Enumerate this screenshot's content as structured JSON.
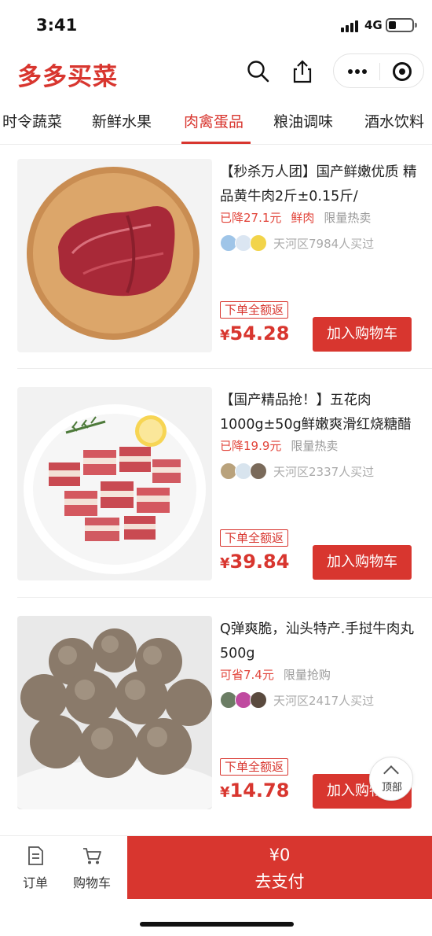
{
  "status_bar": {
    "time": "3:41",
    "network": "4G"
  },
  "header": {
    "brand": "多多买菜",
    "icons": [
      "search-icon",
      "share-icon",
      "more-dots-icon",
      "target-icon"
    ]
  },
  "tabs": [
    {
      "label": "时令蔬菜",
      "active": false
    },
    {
      "label": "新鲜水果",
      "active": false
    },
    {
      "label": "肉禽蛋品",
      "active": true
    },
    {
      "label": "粮油调味",
      "active": false
    },
    {
      "label": "酒水饮料",
      "active": false
    }
  ],
  "products": [
    {
      "title": "【秒杀万人团】国产鲜嫩优质 精品黄牛肉2斤±0.15斤/",
      "tags_red": [
        "已降27.1元",
        "鲜肉"
      ],
      "tags_gray": [
        "限量热卖"
      ],
      "buyers": "天河区7984人买过",
      "cashback": "下单全额返",
      "currency": "¥",
      "price": "54.28",
      "button": "加入购物车"
    },
    {
      "title": "【国产精品抢！】五花肉1000g±50g鲜嫩爽滑红烧糖醋",
      "tags_red": [
        "已降19.9元"
      ],
      "tags_gray": [
        "限量热卖"
      ],
      "buyers": "天河区2337人买过",
      "cashback": "下单全额返",
      "currency": "¥",
      "price": "39.84",
      "button": "加入购物车"
    },
    {
      "title": "Q弹爽脆，汕头特产.手挝牛肉丸500g",
      "tags_red": [
        "可省7.4元"
      ],
      "tags_gray": [
        "限量抢购"
      ],
      "buyers": "天河区2417人买过",
      "cashback": "下单全额返",
      "currency": "¥",
      "price": "14.78",
      "button": "加入购物车"
    }
  ],
  "back_to_top": "顶部",
  "bottom_bar": {
    "orders_label": "订单",
    "cart_label": "购物车",
    "pay_amount": "¥0",
    "pay_label": "去支付"
  },
  "colors": {
    "accent": "#d8362f",
    "tag_red": "#e2463c",
    "muted": "#999999"
  }
}
